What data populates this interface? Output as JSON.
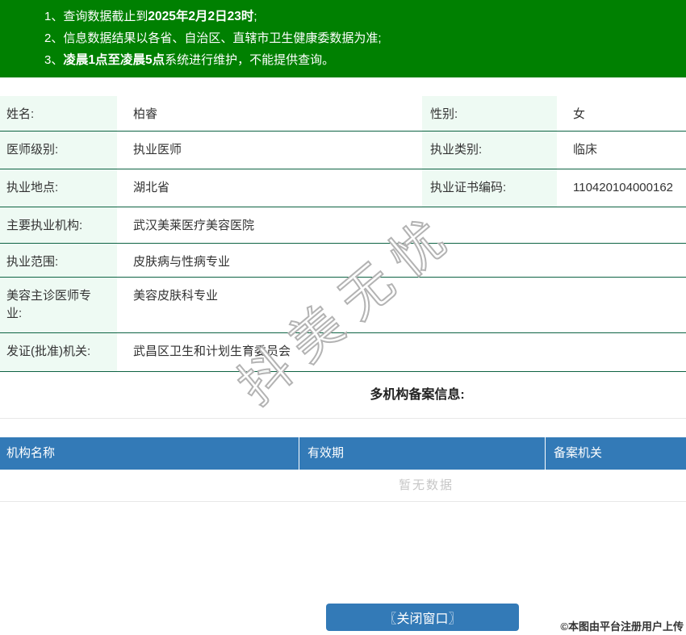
{
  "colors": {
    "banner_green": "#008001",
    "border_green": "#0e6343",
    "label_bg": "#eefaf3",
    "primary_blue": "#337ab7"
  },
  "notice_bar": {
    "items": [
      {
        "num": "1、",
        "pre": "查询数据截止到",
        "bold": "2025年2月2日23时",
        "post": ";"
      },
      {
        "num": "2、",
        "pre": "信息数据结果以各省、自治区、直辖市卫生健康委数据为准;",
        "bold": "",
        "post": ""
      },
      {
        "num": "3、",
        "pre": "",
        "bold": "凌晨1点至凌晨5点",
        "post": "系统进行维护，不能提供查询。"
      }
    ]
  },
  "profile": {
    "rows": [
      {
        "label": "姓名:",
        "value": "柏睿",
        "label2": "性别:",
        "value2": "女"
      },
      {
        "label": "医师级别:",
        "value": "执业医师",
        "label2": "执业类别:",
        "value2": "临床"
      },
      {
        "label": "执业地点:",
        "value": "湖北省",
        "label2": "执业证书编码:",
        "value2": "110420104000162"
      },
      {
        "label": "主要执业机构:",
        "value": "武汉美莱医疗美容医院"
      },
      {
        "label": "执业范围:",
        "value": "皮肤病与性病专业"
      },
      {
        "label": "美容主诊医师专业:",
        "value": "美容皮肤科专业"
      },
      {
        "label": "发证(批准)机关:",
        "value": "武昌区卫生和计划生育委员会"
      }
    ]
  },
  "records": {
    "section_title": "多机构备案信息:",
    "columns": [
      "机构名称",
      "有效期",
      "备案机关"
    ],
    "empty_text": "暂无数据"
  },
  "close_button_label": "〖关闭窗口〗",
  "upload_note": "©本图由平台注册用户上传",
  "watermark_text": "抖美无忧"
}
